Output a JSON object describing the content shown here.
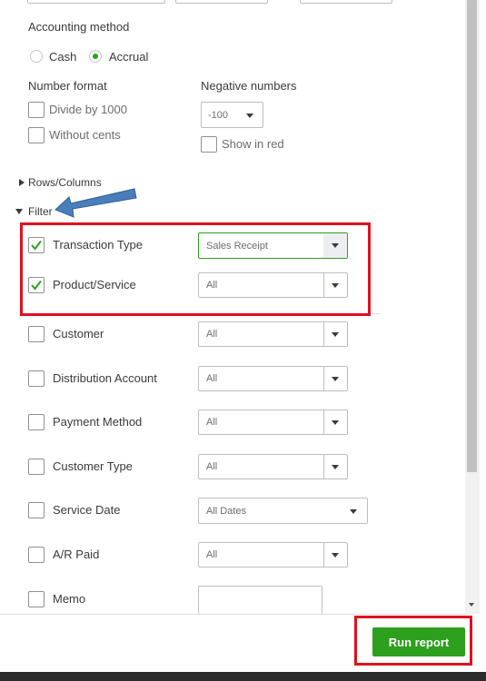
{
  "accounting_method": {
    "label": "Accounting method",
    "options": [
      {
        "label": "Cash",
        "selected": false
      },
      {
        "label": "Accrual",
        "selected": true
      }
    ]
  },
  "number_format": {
    "label": "Number format",
    "options": [
      {
        "label": "Divide by 1000",
        "checked": false
      },
      {
        "label": "Without cents",
        "checked": false
      }
    ]
  },
  "negative_numbers": {
    "label": "Negative numbers",
    "selected": "-100",
    "show_in_red_label": "Show in red",
    "show_in_red_checked": false
  },
  "sections": {
    "rows_columns": "Rows/Columns",
    "filter": "Filter"
  },
  "filters": [
    {
      "label": "Transaction Type",
      "checked": true,
      "value": "Sales Receipt"
    },
    {
      "label": "Product/Service",
      "checked": true,
      "value": "All"
    },
    {
      "label": "Customer",
      "checked": false,
      "value": "All"
    },
    {
      "label": "Distribution Account",
      "checked": false,
      "value": "All"
    },
    {
      "label": "Payment Method",
      "checked": false,
      "value": "All"
    },
    {
      "label": "Customer Type",
      "checked": false,
      "value": "All"
    },
    {
      "label": "Service Date",
      "checked": false,
      "value": "All Dates"
    },
    {
      "label": "A/R Paid",
      "checked": false,
      "value": "All"
    },
    {
      "label": "Memo",
      "checked": false,
      "value": ""
    }
  ],
  "run_report_label": "Run report",
  "colors": {
    "accent_green": "#2ca01c",
    "highlight_red": "#e0101e",
    "arrow_blue": "#4a7ebb"
  }
}
